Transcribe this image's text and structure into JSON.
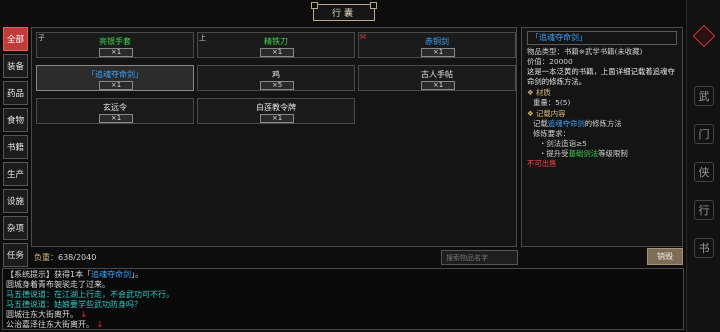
{
  "title": "行囊",
  "tabs": [
    "全部",
    "装备",
    "药品",
    "食物",
    "书籍",
    "生产",
    "设施",
    "杂项",
    "任务"
  ],
  "active_tab": 0,
  "items": [
    {
      "name": "亮银手套",
      "qty": "×1",
      "color": "#3fd34f",
      "corner": "子"
    },
    {
      "name": "精铁刀",
      "qty": "×1",
      "color": "#3fd34f",
      "corner": "上"
    },
    {
      "name": "赤铜剑",
      "qty": "×1",
      "color": "#3aa3ff",
      "corner": "M"
    },
    {
      "name": "「追魂夺命剑」",
      "qty": "×1",
      "color": "#3aa3ff",
      "corner": ""
    },
    {
      "name": "鸡",
      "qty": "×5",
      "color": "#e6e6e6",
      "corner": ""
    },
    {
      "name": "古人手帖",
      "qty": "×1",
      "color": "#e6e6e6",
      "corner": ""
    },
    {
      "name": "玄远令",
      "qty": "×1",
      "color": "#e6e6e6",
      "corner": ""
    },
    {
      "name": "白莲教令牌",
      "qty": "×1",
      "color": "#e6e6e6",
      "corner": ""
    }
  ],
  "detail": {
    "title": "「追魂夺命剑」",
    "type_line": "物品类型：书籍※武学书籍(未收藏)",
    "price_line": "价值：20000",
    "desc": "这是一本泛黄的书籍，上面详细记载着追魂夺命剑的修炼方法。",
    "material_head": "材质",
    "weight_line": "重量：5(5)",
    "record_head": "记载内容",
    "record_prefix": "记载",
    "record_skill": "追魂夺命剑",
    "record_suffix": "的修炼方法",
    "req_head": "修炼要求：",
    "req1": "・剑法造诣≥5",
    "req2_prefix": "・提升受",
    "req2_skill": "基础剑法",
    "req2_suffix": "等级限制",
    "unsellable": "不可出售"
  },
  "footer": {
    "weight_label": "负重：",
    "weight_value": "638/2040",
    "search_placeholder": "搜索物品名字",
    "destroy_label": "销毁"
  },
  "log": {
    "l1_pre": "【系统提示】获得1本「",
    "l1_item": "追魂夺命剑",
    "l1_post": "」。",
    "l2": "圆城身着青布袈裟走了过来。",
    "l3": "马五德说道：在江湖上行走，不会武功可不行。",
    "l4": "马五德说道：姑娘要学些武功防身吗？",
    "l5": "圆城往东大街离开。",
    "l6": "公治嘉泽往东大街离开。",
    "arrow": "↓"
  },
  "sidebar_icons": [
    "diamond",
    "武",
    "门",
    "侠",
    "行",
    "书"
  ]
}
